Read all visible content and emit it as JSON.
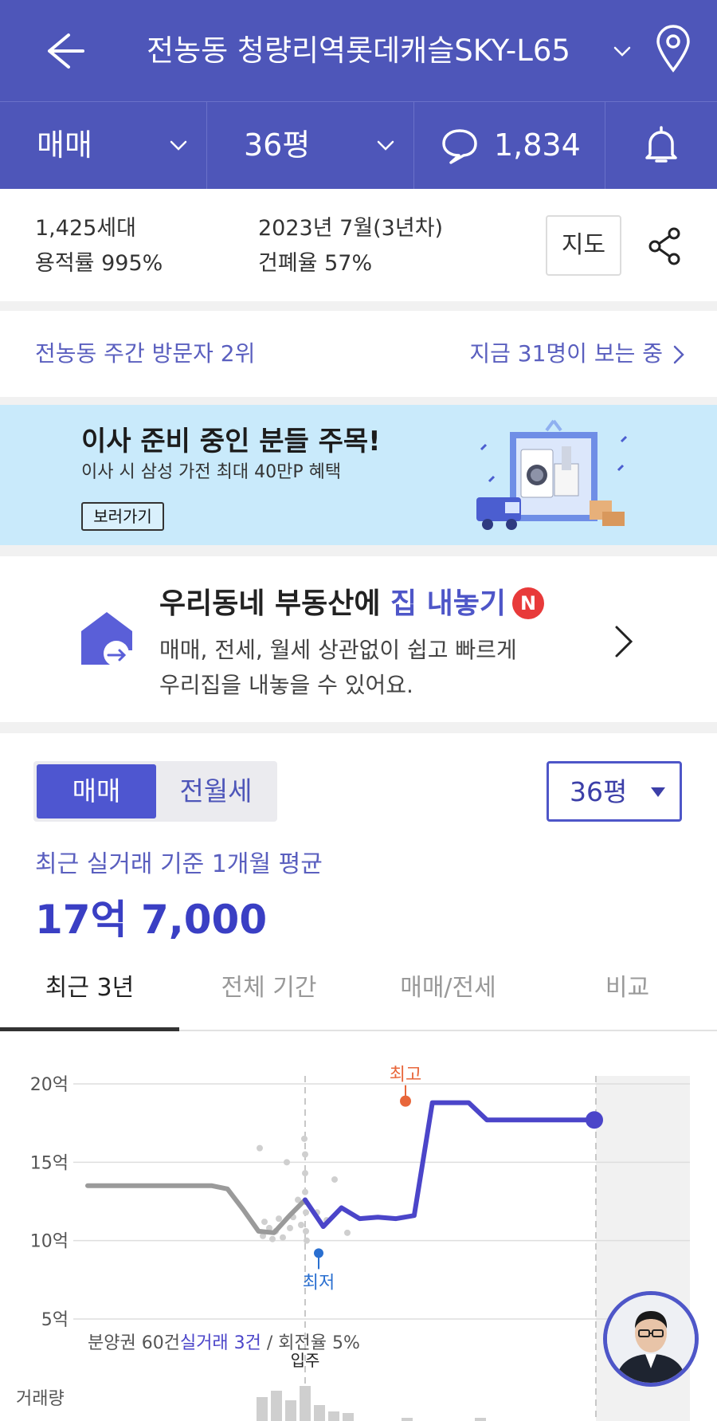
{
  "header": {
    "title": "전농동 청량리역롯데캐슬SKY-L65",
    "back_icon": "arrow-left-icon",
    "location_icon": "map-pin-icon"
  },
  "filters": {
    "deal_type": "매매",
    "size": "36평",
    "comment_count": "1,834"
  },
  "summary": {
    "households": "1,425세대",
    "floor_area_ratio": "용적률 995%",
    "built": "2023년 7월(3년차)",
    "coverage_ratio": "건폐율 57%",
    "map_button": "지도"
  },
  "visitor": {
    "rank_text": "전농동 주간 방문자 2위",
    "viewers_text": "지금 31명이 보는 중"
  },
  "banner": {
    "headline": "이사 준비 중인 분들 주목!",
    "subline": "이사 시 삼성 가전 최대 40만P 혜택",
    "button": "보러가기"
  },
  "listing_promo": {
    "title_prefix": "우리동네 부동산에 ",
    "title_highlight": "집 내놓기",
    "badge": "N",
    "desc_line1": "매매, 전세, 월세 상관없이 쉽고 빠르게",
    "desc_line2": "우리집을 내놓을 수 있어요."
  },
  "price_section": {
    "seg_active": "매매",
    "seg_inactive": "전월세",
    "size_select": "36평",
    "avg_label": "최근 실거래 기준 1개월 평균",
    "avg_value": "17억 7,000"
  },
  "tabs": [
    "최근 3년",
    "전체 기간",
    "매매/전세",
    "비교"
  ],
  "colors": {
    "brand": "#4e56b9",
    "accent": "#3a3fc4",
    "presale_line": "#9a9a9a",
    "price_line": "#4b45c9",
    "high_marker": "#e8663a",
    "low_marker": "#2a6fd0"
  },
  "chart_data": {
    "type": "line",
    "ylabel": "",
    "y_ticks": [
      "20억",
      "15억",
      "10억",
      "5억"
    ],
    "ylim": [
      5,
      20
    ],
    "x_marker_label": "입주",
    "high_label": "최고",
    "low_label": "최저",
    "footnote_prefix": "분양권 60건",
    "footnote_highlight": "실거래 3건",
    "footnote_suffix": " / 회전율 5%",
    "volume_label": "거래량",
    "series": [
      {
        "values": [
          13.5,
          13.5,
          13.5,
          13.5,
          13.5,
          13.5,
          13.5,
          13.5,
          13.5,
          13.3,
          12.0,
          10.6,
          10.5,
          11.6,
          12.6
        ]
      },
      {
        "values": [
          12.6,
          10.9,
          12.1,
          11.4,
          11.5,
          11.4,
          11.6,
          18.8,
          18.8,
          18.8,
          17.7,
          17.7,
          17.7,
          17.7,
          17.7,
          17.7,
          17.7
        ]
      }
    ],
    "high_value": 18.9,
    "low_value": 9.2,
    "last_value": 17.7
  }
}
